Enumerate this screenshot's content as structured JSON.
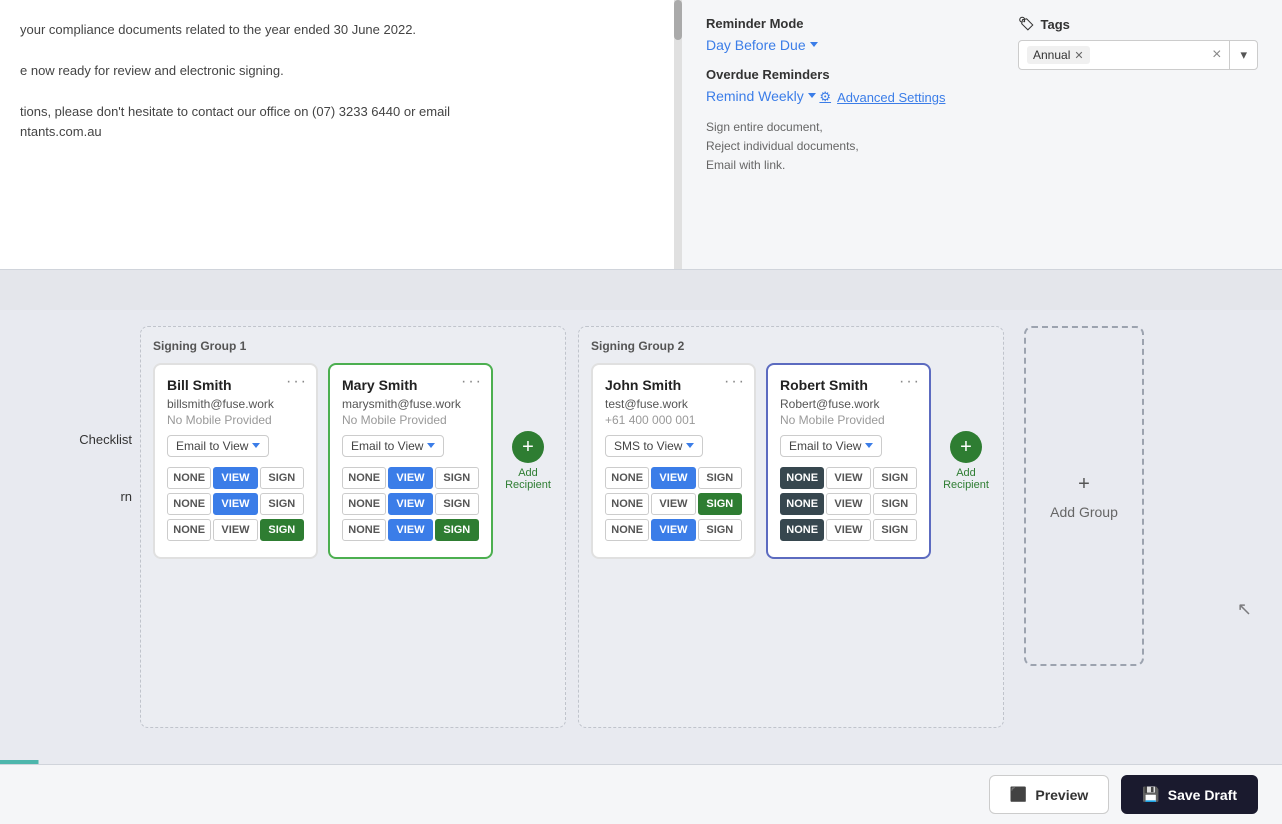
{
  "top": {
    "left_text_lines": [
      "your compliance documents related to the year ended 30 June 2022.",
      "",
      "e now ready for review and electronic signing.",
      "",
      "tions, please don't hesitate to contact our office on (07) 3233 6440 or email",
      "ntants.com.au"
    ],
    "reminder_mode_label": "Reminder Mode",
    "reminder_mode_value": "Day Before Due",
    "overdue_label": "Overdue Reminders",
    "overdue_value": "Remind Weekly",
    "advanced_settings_label": "Advanced Settings",
    "advanced_settings_desc_line1": "Sign entire document,",
    "advanced_settings_desc_line2": "Reject individual documents,",
    "advanced_settings_desc_line3": "Email with link.",
    "tags_label": "Tags",
    "tag_value": "Annual",
    "tags_clear_symbol": "×",
    "tags_chevron": "▾"
  },
  "signing_group_1": {
    "title": "Signing Group 1",
    "recipients": [
      {
        "name": "Bill Smith",
        "email": "billsmith@fuse.work",
        "mobile": "No Mobile Provided",
        "view_method": "Email to View",
        "border_class": "",
        "rows": [
          {
            "none": "NONE",
            "view": "VIEW",
            "sign": "SIGN",
            "active": "view"
          },
          {
            "none": "NONE",
            "view": "VIEW",
            "sign": "SIGN",
            "active": "view"
          },
          {
            "none": "NONE",
            "view": "VIEW",
            "sign": "SIGN",
            "active": "sign"
          }
        ]
      },
      {
        "name": "Mary Smith",
        "email": "marysmith@fuse.work",
        "mobile": "No Mobile Provided",
        "view_method": "Email to View",
        "border_class": "green-border",
        "rows": [
          {
            "none": "NONE",
            "view": "VIEW",
            "sign": "SIGN",
            "active": "view"
          },
          {
            "none": "NONE",
            "view": "VIEW",
            "sign": "SIGN",
            "active": "view"
          },
          {
            "none": "NONE",
            "view": "VIEW",
            "sign": "SIGN",
            "active": "sign"
          }
        ]
      }
    ],
    "add_recipient_label": "Add\nRecipient"
  },
  "signing_group_2": {
    "title": "Signing Group 2",
    "recipients": [
      {
        "name": "John Smith",
        "email": "test@fuse.work",
        "mobile": "+61 400 000 001",
        "view_method": "SMS to View",
        "border_class": "",
        "rows": [
          {
            "none": "NONE",
            "view": "VIEW",
            "sign": "SIGN",
            "active": "view"
          },
          {
            "none": "NONE",
            "view": "VIEW",
            "sign": "SIGN",
            "active": "sign"
          },
          {
            "none": "NONE",
            "view": "VIEW",
            "sign": "SIGN",
            "active": "view"
          }
        ]
      },
      {
        "name": "Robert Smith",
        "email": "Robert@fuse.work",
        "mobile": "No Mobile Provided",
        "view_method": "Email to View",
        "border_class": "purple-border",
        "rows": [
          {
            "none": "NONE",
            "view": "VIEW",
            "sign": "SIGN",
            "active": "none"
          },
          {
            "none": "NONE",
            "view": "VIEW",
            "sign": "SIGN",
            "active": "none"
          },
          {
            "none": "NONE",
            "view": "VIEW",
            "sign": "SIGN",
            "active": "none"
          }
        ]
      }
    ],
    "add_recipient_label": "Add\nRecipient"
  },
  "add_group": {
    "plus": "+",
    "label": "Add Group"
  },
  "row_labels": [
    "",
    "Checklist",
    "rn"
  ],
  "footer": {
    "preview_label": "Preview",
    "save_draft_label": "Save Draft"
  },
  "icons": {
    "gear": "⚙",
    "tag": "🏷",
    "menu_dots": "···",
    "chevron_down": "▾",
    "preview_icon": "⬜",
    "save_icon": "💾"
  }
}
